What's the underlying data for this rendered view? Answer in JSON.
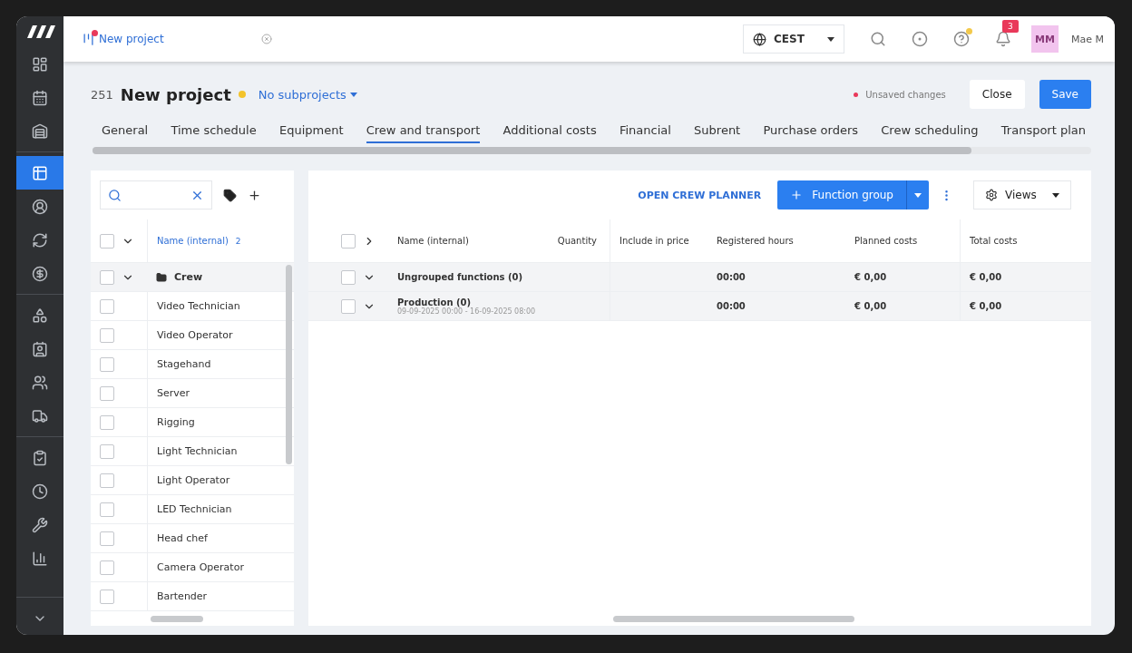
{
  "sidebar": {
    "items": [
      {
        "kind": "dashboard",
        "selected": false
      },
      {
        "kind": "calendar",
        "selected": false
      },
      {
        "kind": "warehouse",
        "selected": false
      },
      {
        "kind": "table",
        "selected": true
      },
      {
        "kind": "person",
        "selected": false
      },
      {
        "kind": "refresh",
        "selected": false
      },
      {
        "kind": "dollar",
        "selected": false
      },
      {
        "kind": "shapes",
        "selected": false
      },
      {
        "kind": "contact",
        "selected": false
      },
      {
        "kind": "people",
        "selected": false
      },
      {
        "kind": "truck",
        "selected": false
      },
      {
        "kind": "clipboard",
        "selected": false
      },
      {
        "kind": "clock",
        "selected": false
      },
      {
        "kind": "wrench",
        "selected": false
      },
      {
        "kind": "chart",
        "selected": false
      }
    ]
  },
  "top_bar": {
    "open_tab": {
      "label": "New project",
      "unsaved": true
    },
    "timezone": "CEST",
    "notifications": "3",
    "help_dot": true,
    "avatar": "MM",
    "user": "Mae M"
  },
  "header": {
    "number": "251",
    "title": "New project",
    "status_dot": true,
    "subprojects": "No subprojects",
    "unsaved": "Unsaved changes",
    "buttons": [
      {
        "label": "Close",
        "kind": "secondary"
      },
      {
        "label": "Save",
        "kind": "primary"
      }
    ]
  },
  "tabs": [
    {
      "label": "General",
      "selected": false
    },
    {
      "label": "Time schedule",
      "selected": false
    },
    {
      "label": "Equipment",
      "selected": false
    },
    {
      "label": "Crew and transport",
      "selected": true
    },
    {
      "label": "Additional costs",
      "selected": false
    },
    {
      "label": "Financial",
      "selected": false
    },
    {
      "label": "Subrent",
      "selected": false
    },
    {
      "label": "Purchase orders",
      "selected": false
    },
    {
      "label": "Crew scheduling",
      "selected": false
    },
    {
      "label": "Transport plan",
      "selected": false
    }
  ],
  "functions_panel": {
    "header": {
      "label": "Name (internal)",
      "sort_index": "2",
      "checked": false
    },
    "rows": [
      {
        "name": "Crew",
        "checked": false,
        "expanded": true,
        "children": [
          {
            "name": "Video Technician",
            "checked": false
          },
          {
            "name": "Video Operator",
            "checked": false
          },
          {
            "name": "Stagehand",
            "checked": false
          },
          {
            "name": "Server",
            "checked": false
          },
          {
            "name": "Rigging",
            "checked": false
          },
          {
            "name": "Light Technician",
            "checked": false
          },
          {
            "name": "Light Operator",
            "checked": false
          },
          {
            "name": "LED Technician",
            "checked": false
          },
          {
            "name": "Head chef",
            "checked": false
          },
          {
            "name": "Camera Operator",
            "checked": false
          },
          {
            "name": "Bartender",
            "checked": false
          }
        ]
      }
    ]
  },
  "planning_panel": {
    "header_checked": false,
    "open_planner": "OPEN CREW PLANNER",
    "add_button": "Function group",
    "views": "Views",
    "columns": [
      "Name (internal)",
      "Quantity",
      "Include in price",
      "Registered hours",
      "Planned costs",
      "Total costs"
    ],
    "rows": [
      {
        "name": "Ungrouped functions (0)",
        "checked": false,
        "expanded": true,
        "registered_hours": "00:00",
        "planned_costs": "€ 0,00",
        "total_costs": "€ 0,00"
      },
      {
        "name": "Production (0)",
        "period": "09-09-2025 00:00 - 16-09-2025 08:00",
        "checked": false,
        "expanded": true,
        "registered_hours": "00:00",
        "planned_costs": "€ 0,00",
        "total_costs": "€ 0,00"
      }
    ]
  }
}
